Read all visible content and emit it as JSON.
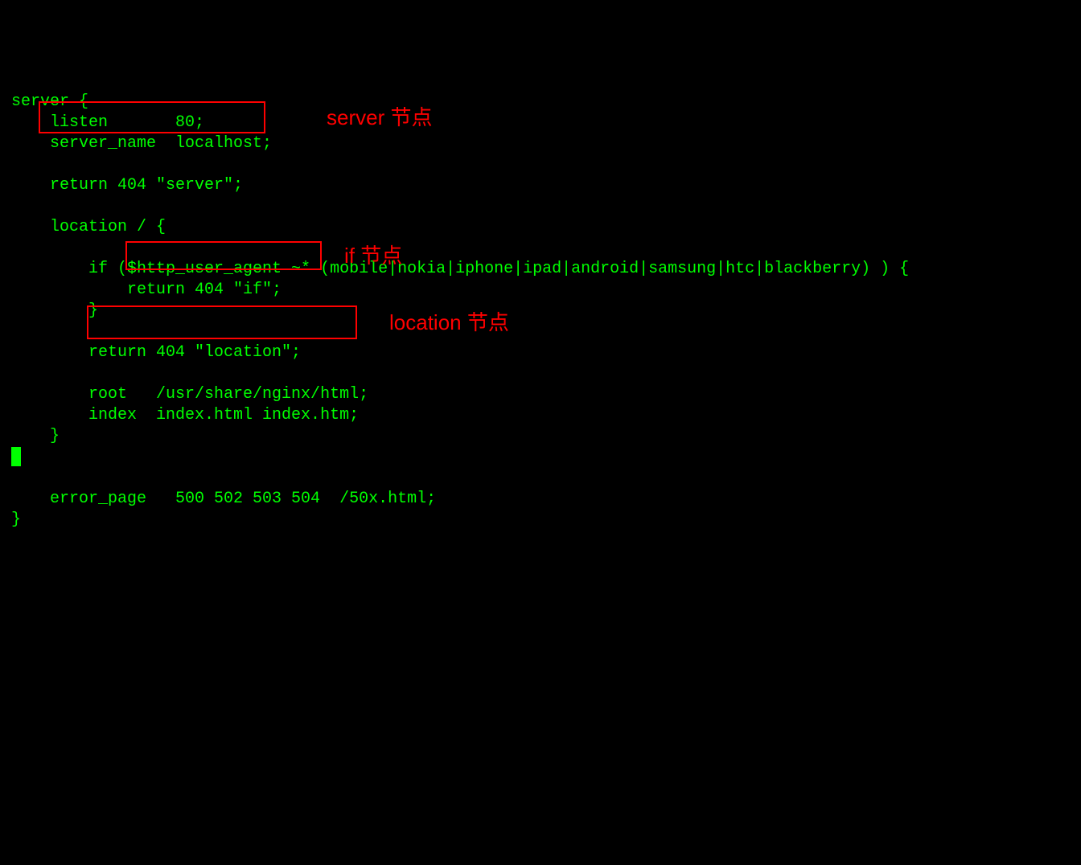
{
  "code": {
    "l1": "server {",
    "l2": "    listen       80;",
    "l3": "    server_name  localhost;",
    "l4": "",
    "l5": "    return 404 \"server\";",
    "l6": "",
    "l7": "    location / {",
    "l8": "",
    "l9": "        if ($http_user_agent ~* (mobile|nokia|iphone|ipad|android|samsung|htc|blackberry) ) {",
    "l10": "            return 404 \"if\";",
    "l11": "        }",
    "l12": "",
    "l13": "        return 404 \"location\";",
    "l14": "",
    "l15": "        root   /usr/share/nginx/html;",
    "l16": "        index  index.html index.htm;",
    "l17": "    }",
    "l18": "",
    "l19": "",
    "l20": "    error_page   500 502 503 504  /50x.html;",
    "l21": "}"
  },
  "annotations": {
    "server": "server 节点",
    "if": "if 节点",
    "location": "location 节点"
  }
}
